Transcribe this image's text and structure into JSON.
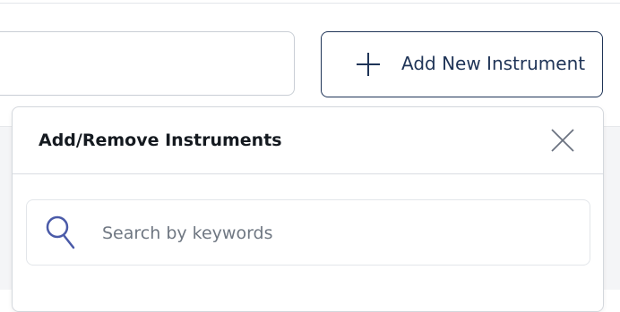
{
  "toolbar": {
    "add_button_label": "Add New Instrument"
  },
  "panel": {
    "title": "Add/Remove Instruments",
    "search": {
      "placeholder": "Search by keywords",
      "value": ""
    }
  },
  "icons": {
    "add": "plus-icon",
    "close": "close-icon",
    "search": "search-icon"
  },
  "colors": {
    "accent": "#1f3457",
    "search_icon": "#4a5aa8",
    "close_icon": "#6b7280"
  }
}
